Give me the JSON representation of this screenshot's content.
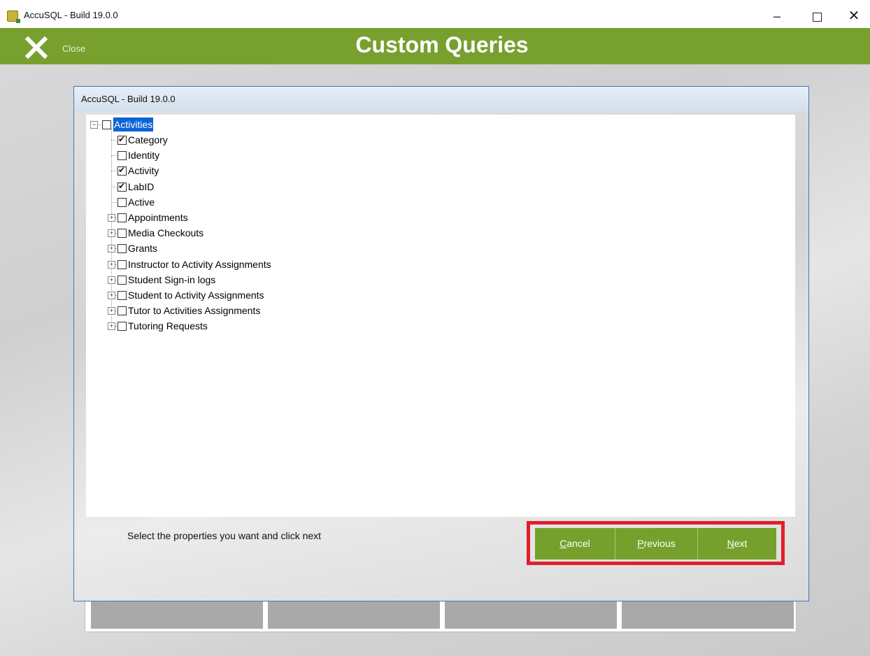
{
  "window": {
    "title": "AccuSQL - Build 19.0.0",
    "minimize_glyph": "–",
    "close_glyph": "✕"
  },
  "header": {
    "close_label": "Close",
    "title": "Custom Queries",
    "accent_color": "#77a02f"
  },
  "dialog": {
    "title": "AccuSQL - Build 19.0.0",
    "hint": "Select the properties you want and click next"
  },
  "tree": {
    "root": {
      "label": "Activities",
      "expanded": true,
      "checked": false,
      "selected": true
    },
    "fields": [
      {
        "label": "Category",
        "checked": true
      },
      {
        "label": "Identity",
        "checked": false
      },
      {
        "label": "Activity",
        "checked": true
      },
      {
        "label": "LabID",
        "checked": true
      },
      {
        "label": "Active",
        "checked": false
      }
    ],
    "relations": [
      {
        "label": "Appointments",
        "checked": false
      },
      {
        "label": "Media Checkouts",
        "checked": false
      },
      {
        "label": "Grants",
        "checked": false
      },
      {
        "label": "Instructor to Activity Assignments",
        "checked": false
      },
      {
        "label": "Student Sign-in logs",
        "checked": false
      },
      {
        "label": "Student to Activity Assignments",
        "checked": false
      },
      {
        "label": "Tutor to Activities Assignments",
        "checked": false
      },
      {
        "label": "Tutoring Requests",
        "checked": false
      }
    ]
  },
  "buttons": {
    "cancel": {
      "mnemonic": "C",
      "rest": "ancel"
    },
    "previous": {
      "mnemonic": "P",
      "rest": "revious"
    },
    "next": {
      "mnemonic": "N",
      "rest": "ext"
    },
    "highlight_color": "#e0202a"
  }
}
